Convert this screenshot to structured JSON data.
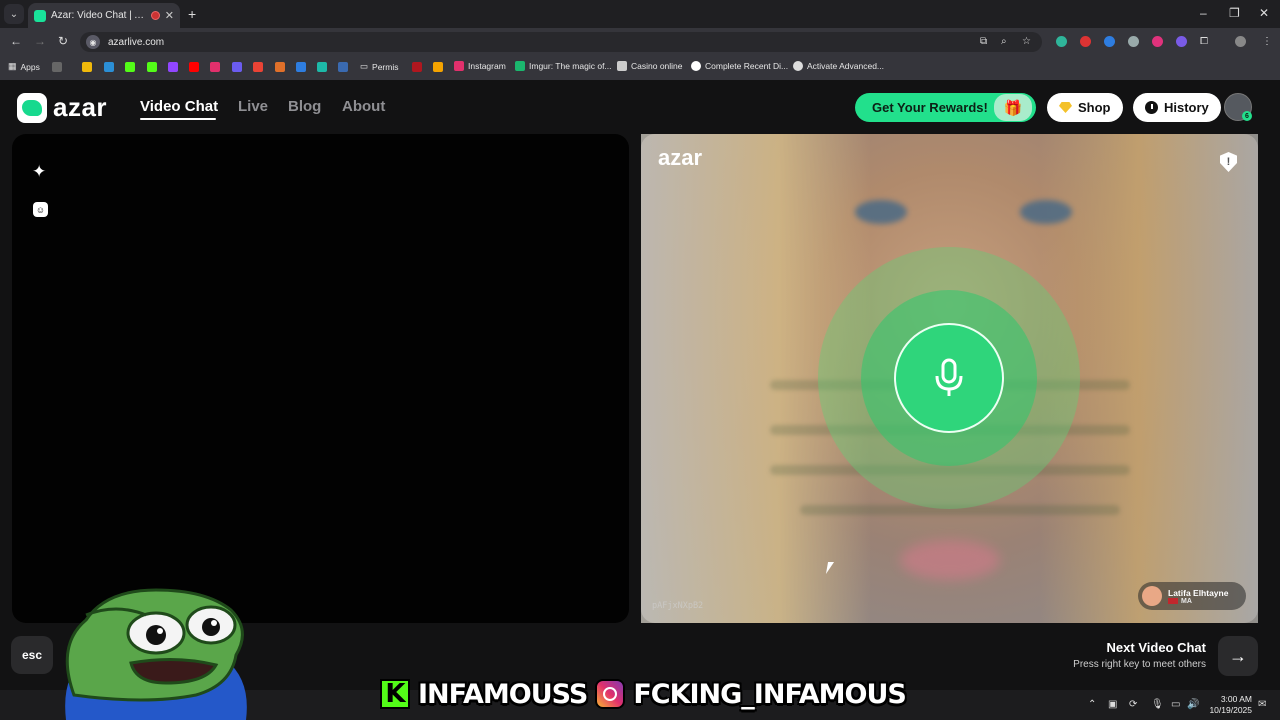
{
  "browser": {
    "tab_title": "Azar: Video Chat | Alternativ",
    "url": "azarlive.com",
    "bookmarks": [
      "Apps",
      "Permis",
      "Instagram",
      "Imgur: The magic of...",
      "Casino online",
      "Complete Recent Di...",
      "Activate Advanced..."
    ]
  },
  "site": {
    "logo_text": "azar",
    "nav": [
      "Video Chat",
      "Live",
      "Blog",
      "About"
    ],
    "rewards_label": "Get Your Rewards!",
    "shop_label": "Shop",
    "history_label": "History",
    "avatar_badge": "6"
  },
  "video": {
    "remote_logo": "azar",
    "partner_id": "pAFjxNXpB2",
    "partner_name": "Latifa Elhtayne",
    "partner_country": "MA",
    "shield_mark": "!"
  },
  "footer": {
    "esc_label": "esc",
    "next_title": "Next Video Chat",
    "next_sub": "Press right key to meet others"
  },
  "overlay": {
    "kick_name": "INFAMOUSS",
    "ig_name": "FCKING_INFAMOUS"
  },
  "taskbar": {
    "time": "3:00 AM",
    "date": "10/19/2025"
  }
}
